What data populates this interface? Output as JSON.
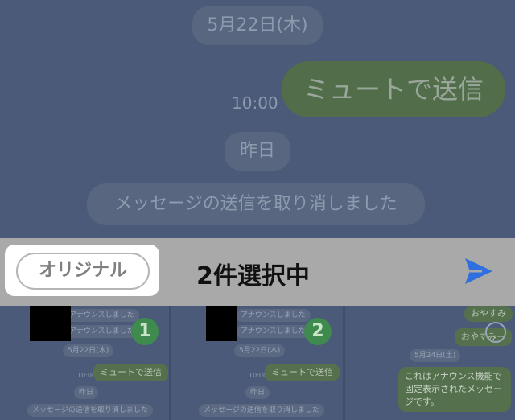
{
  "chat": {
    "date_label": "5月22日(木)",
    "message": "ミュートで送信",
    "time": "10:00",
    "yesterday_label": "昨日",
    "system_message": "メッセージの送信を取り消しました"
  },
  "toolbar": {
    "original_label": "オリジナル",
    "selection_count": "2件選択中",
    "send_icon": "send-icon"
  },
  "thumbnails": [
    {
      "announce_1": "アナウンスしました",
      "announce_2": "アナウンスしました",
      "date": "5月22日(木)",
      "time": "10:00",
      "message": "ミュートで送信",
      "yesterday": "昨日",
      "system_message": "メッセージの送信を取り消しました",
      "badge": "1"
    },
    {
      "announce_1": "アナウンスしました",
      "announce_2": "アナウンスしました",
      "date": "5月22日(木)",
      "time": "10:00",
      "message": "ミュートで送信",
      "yesterday": "昨日",
      "system_message": "メッセージの送信を取り消しました",
      "badge": "2"
    },
    {
      "msg_1": "おやすみ",
      "msg_2": "おやすみー",
      "date": "5月24日(土)",
      "notice": "これはアナウンス機能で固定表示されたメッセージです。"
    }
  ],
  "colors": {
    "accent_send": "#2f6fe0",
    "badge_green": "#3f8a4e",
    "toolbar_bg": "#a9a9a9"
  }
}
